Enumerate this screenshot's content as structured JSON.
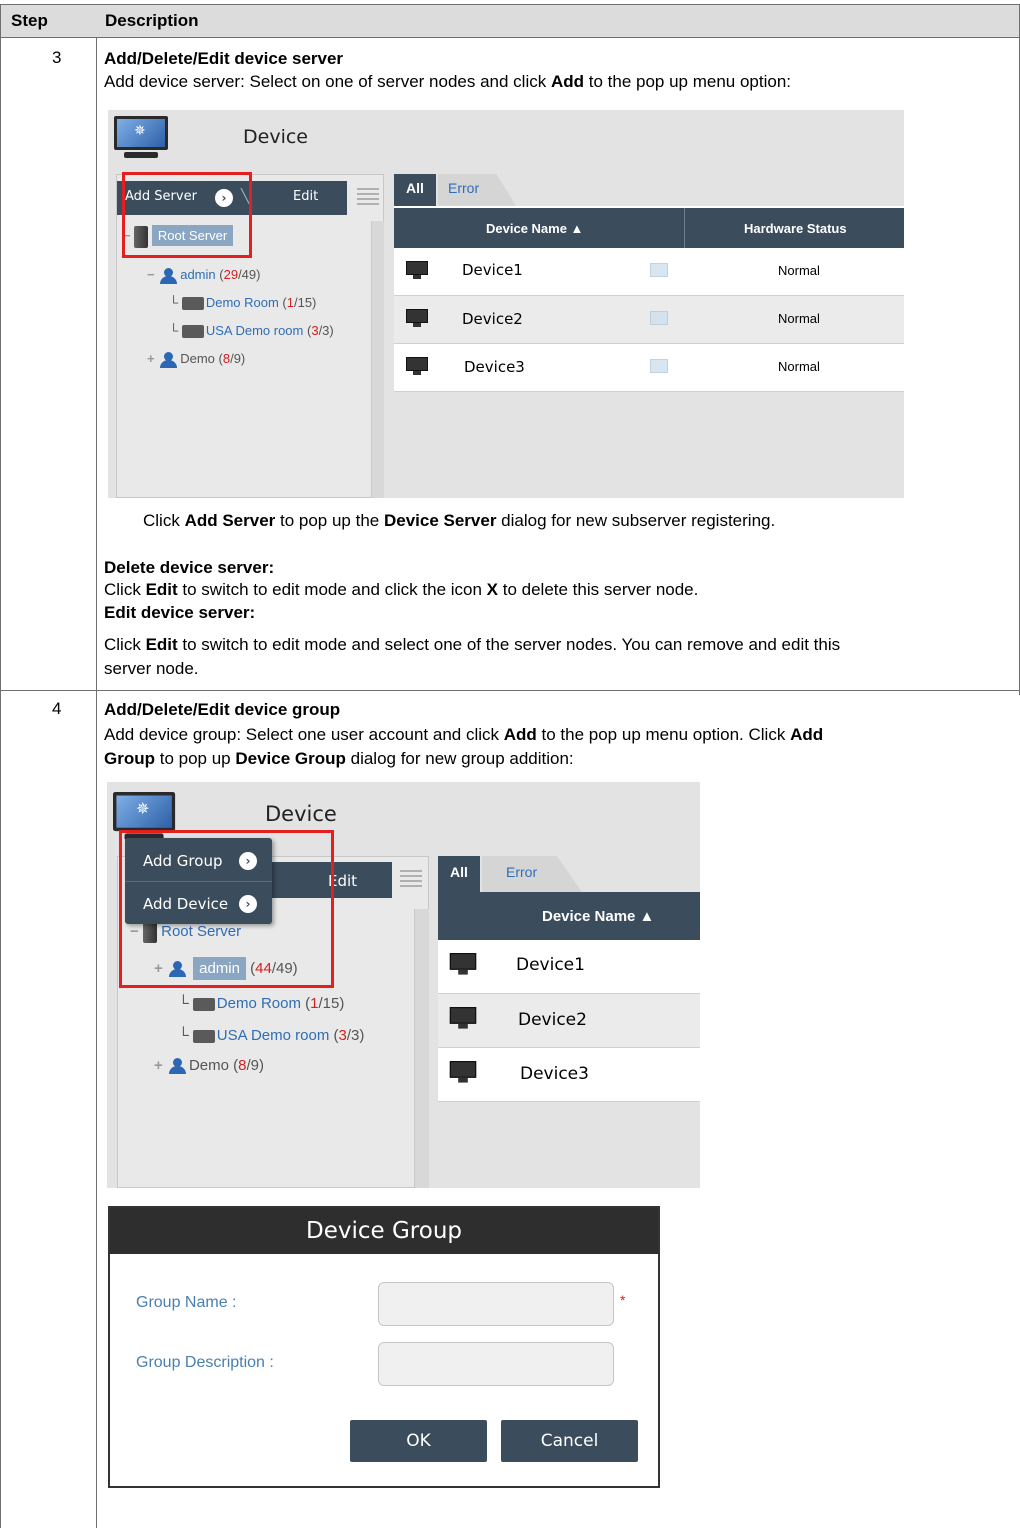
{
  "table": {
    "header": {
      "step": "Step",
      "description": "Description"
    },
    "row3": {
      "step": "3",
      "title": "Add/Delete/Edit device server",
      "line1_a": "Add device server: Select on one of server nodes and click ",
      "line1_b": "Add",
      "line1_c": " to the pop up menu option:",
      "caption_a": "Click ",
      "caption_b": "Add Server",
      "caption_c": " to pop up the ",
      "caption_d": "Device Server",
      "caption_e": " dialog for new subserver registering.",
      "delete_title": "Delete device server:",
      "delete_a": "Click ",
      "delete_b": "Edit",
      "delete_c": " to switch to edit mode and click the icon ",
      "delete_d": "X",
      "delete_e": " to delete this server node.",
      "edit_title": "Edit device server:",
      "edit_a": "Click ",
      "edit_b": "Edit",
      "edit_c": " to switch to edit mode and select one of the server nodes. You can remove and edit this",
      "edit_d": "server node."
    },
    "row4": {
      "step": "4",
      "title": "Add/Delete/Edit device group",
      "line1_a": "Add device group: Select one user account and click ",
      "line1_b": "Add",
      "line1_c": " to the pop up menu option. Click ",
      "line1_d": "Add",
      "line2_a": "Group",
      "line2_b": " to pop up ",
      "line2_c": "Device Group",
      "line2_d": " dialog for new group addition:"
    }
  },
  "shot1": {
    "title": "Device",
    "add_server": "Add Server",
    "edit": "Edit",
    "root_server": "Root Server",
    "tree": {
      "admin": "admin",
      "admin_open": " (",
      "admin_red": "29",
      "admin_rest": "/49)",
      "demo_room": "Demo Room",
      "demo_room_open": " (",
      "demo_room_red": "1",
      "demo_room_rest": "/15)",
      "usa_room": "USA Demo room",
      "usa_open": " (",
      "usa_red": "3",
      "usa_rest": "/3)",
      "demo": "Demo",
      "demo_open": " (",
      "demo_red": "8",
      "demo_rest": "/9)"
    },
    "tab_all": "All",
    "tab_error": "Error",
    "col_name": "Device Name ▲",
    "col_hw": "Hardware Status",
    "rows": [
      {
        "name": "Device1",
        "status": "Normal"
      },
      {
        "name": "Device2",
        "status": "Normal"
      },
      {
        "name": "Device3",
        "status": "Normal"
      }
    ]
  },
  "shot2": {
    "title": "Device",
    "menu_add_group": "Add Group",
    "menu_add_device": "Add Device",
    "edit": "Edit",
    "root_server": "Root Server",
    "tree": {
      "admin": "admin",
      "admin_open": " (",
      "admin_red": "44",
      "admin_rest": "/49)",
      "demo_room": "Demo Room",
      "demo_room_open": " (",
      "demo_room_red": "1",
      "demo_room_rest": "/15)",
      "usa_room": "USA Demo room",
      "usa_open": " (",
      "usa_red": "3",
      "usa_rest": "/3)",
      "demo": "Demo",
      "demo_open": " (",
      "demo_red": "8",
      "demo_rest": "/9)"
    },
    "tab_all": "All",
    "tab_error": "Error",
    "col_name": "Device Name ▲",
    "rows": [
      "Device1",
      "Device2",
      "Device3"
    ]
  },
  "dialog": {
    "title": "Device Group",
    "group_name_label": "Group Name :",
    "group_desc_label": "Group Description :",
    "required_mark": "*",
    "ok": "OK",
    "cancel": "Cancel"
  },
  "icons": {
    "monitor": "monitor-icon",
    "arrow": "chevron-right-circle-icon",
    "pencil": "pencil-icon",
    "list": "list-icon",
    "user": "user-icon",
    "folder": "folder-icon",
    "server": "server-icon",
    "device": "desktop-icon"
  },
  "colors": {
    "highlight": "#e41f1f",
    "toolbar": "#3b4c5c",
    "link": "#2f6db5"
  }
}
